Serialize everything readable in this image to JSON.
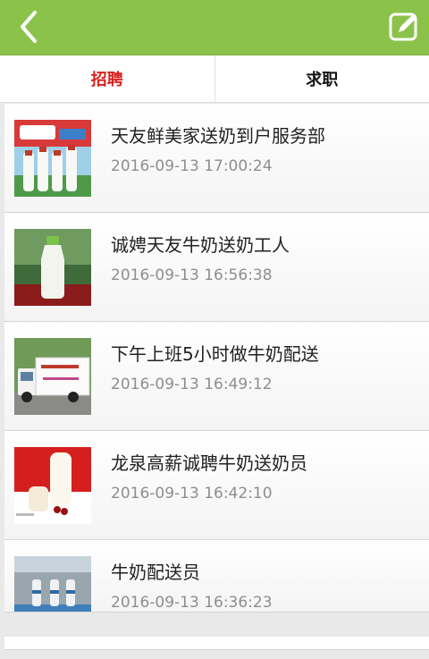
{
  "header": {
    "back_icon": "chevron-left-icon",
    "edit_icon": "edit-icon",
    "color": "#8bc34a"
  },
  "tabs": [
    {
      "label": "招聘",
      "active": true
    },
    {
      "label": "求职",
      "active": false
    }
  ],
  "jobs": [
    {
      "title": "天友鲜美家送奶到户服务部",
      "date": "2016-09-13 17:00:24"
    },
    {
      "title": "诚娉天友牛奶送奶工人",
      "date": "2016-09-13 16:56:38"
    },
    {
      "title": "下午上班5小时做牛奶配送",
      "date": "2016-09-13 16:49:12"
    },
    {
      "title": "龙泉高薪诚聘牛奶送奶员",
      "date": "2016-09-13 16:42:10"
    },
    {
      "title": "牛奶配送员",
      "date": "2016-09-13 16:36:23"
    }
  ]
}
